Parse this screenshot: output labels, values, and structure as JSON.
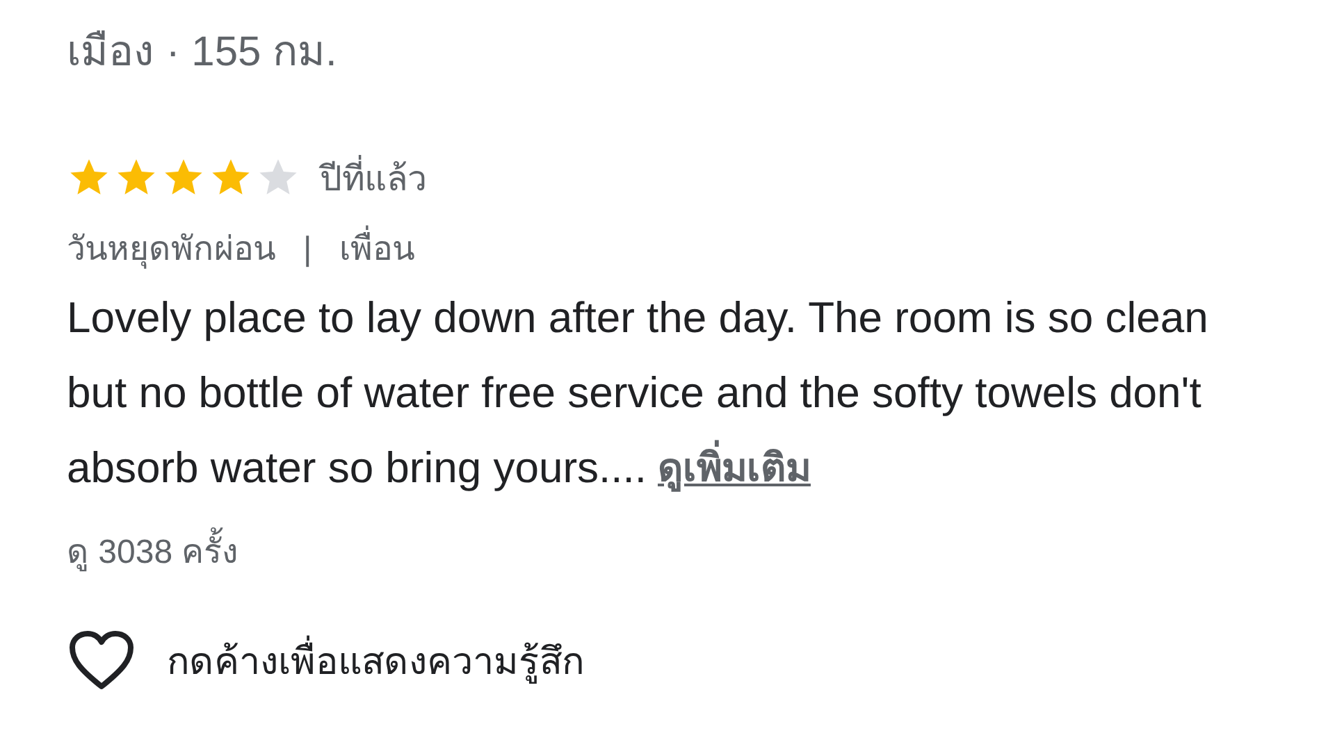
{
  "header": {
    "text": "เมือง · 155 กม."
  },
  "review": {
    "stars": 4,
    "time": "ปีที่แล้ว",
    "trip_type": "วันหยุดพักผ่อน",
    "separator": "|",
    "companion": "เพื่อน",
    "body": "Lovely place to lay down after the day. The room is so clean but no bottle of water free service and the softy towels don't absorb water so bring yours....",
    "more_link": "ดูเพิ่มเติม",
    "views": "ดู 3038 ครั้ง"
  },
  "reaction": {
    "label": "กดค้างเพื่อแสดงความรู้สึก",
    "liked": false
  }
}
